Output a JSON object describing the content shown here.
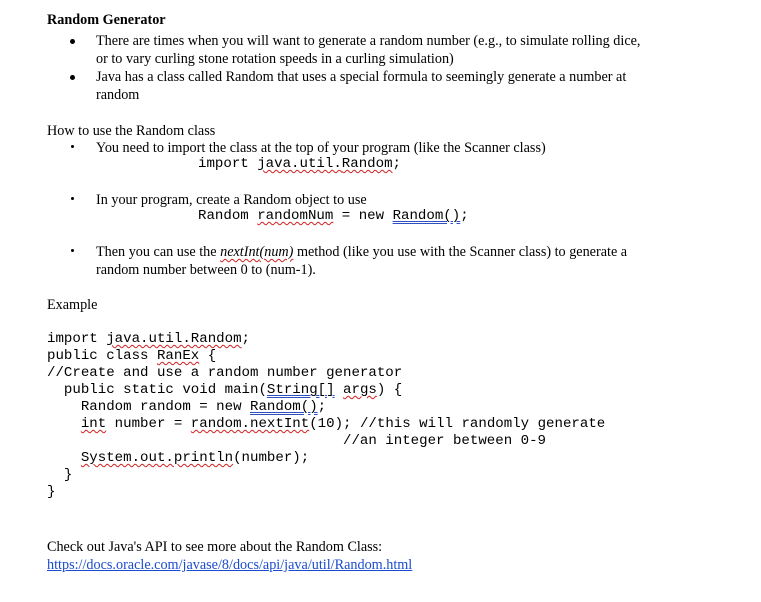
{
  "heading": "Random Generator",
  "intro_bullets": [
    {
      "line1": "There are times when you will want to generate a random number (e.g., to simulate rolling dice,",
      "line2": "or to vary curling stone rotation speeds in a curling simulation)"
    },
    {
      "line1": "Java has a class called Random that uses a special formula to seemingly generate a number at",
      "line2": "random"
    }
  ],
  "howto": {
    "heading": "How to use the Random class",
    "step1": {
      "text": "You need to import the class at the top of your program (like the Scanner class)",
      "code_kw": "import ",
      "code_pkg": "java.util.",
      "code_cls": "Random",
      "code_end": ";"
    },
    "step2": {
      "text": "In your program, create a Random object to use",
      "code_type": "Random ",
      "code_var": "randomNum",
      "code_mid": " = new ",
      "code_ctor": "Random()",
      "code_end": ";"
    },
    "step3": {
      "pre": "Then you can use the ",
      "method_name": "nextInt",
      "method_args": "(num)",
      "post": " method (like you use with the Scanner class) to generate a",
      "line2": "random number between 0 to (num-1)."
    }
  },
  "example": {
    "heading": "Example",
    "code": {
      "l1_kw": "import ",
      "l1_pkg": "java.util.Random",
      "l1_end": ";",
      "l2_kw": "public class ",
      "l2_name": "RanEx",
      "l2_end": " {",
      "l3": "//Create and use a random number generator",
      "l4_pre": "  public static void main(",
      "l4_type": "String[]",
      "l4_sp": " ",
      "l4_arg": "args",
      "l4_end": ") {",
      "l5_pre": "    Random random = new ",
      "l5_ctor": "Random()",
      "l5_end": ";",
      "l6_ind": "    ",
      "l6_int": "int",
      "l6_mid": " number = ",
      "l6_call": "random.nextInt",
      "l6_end": "(10); //this will randomly generate",
      "l7": "                                   //an integer between 0-9",
      "l8_ind": "    ",
      "l8_call": "System.out.println",
      "l8_end": "(number);",
      "l9": "  }",
      "l10": "}"
    }
  },
  "footer": {
    "text": "Check out Java's API to see more about the Random Class:",
    "link": "https://docs.oracle.com/javase/8/docs/api/java/util/Random.html"
  }
}
